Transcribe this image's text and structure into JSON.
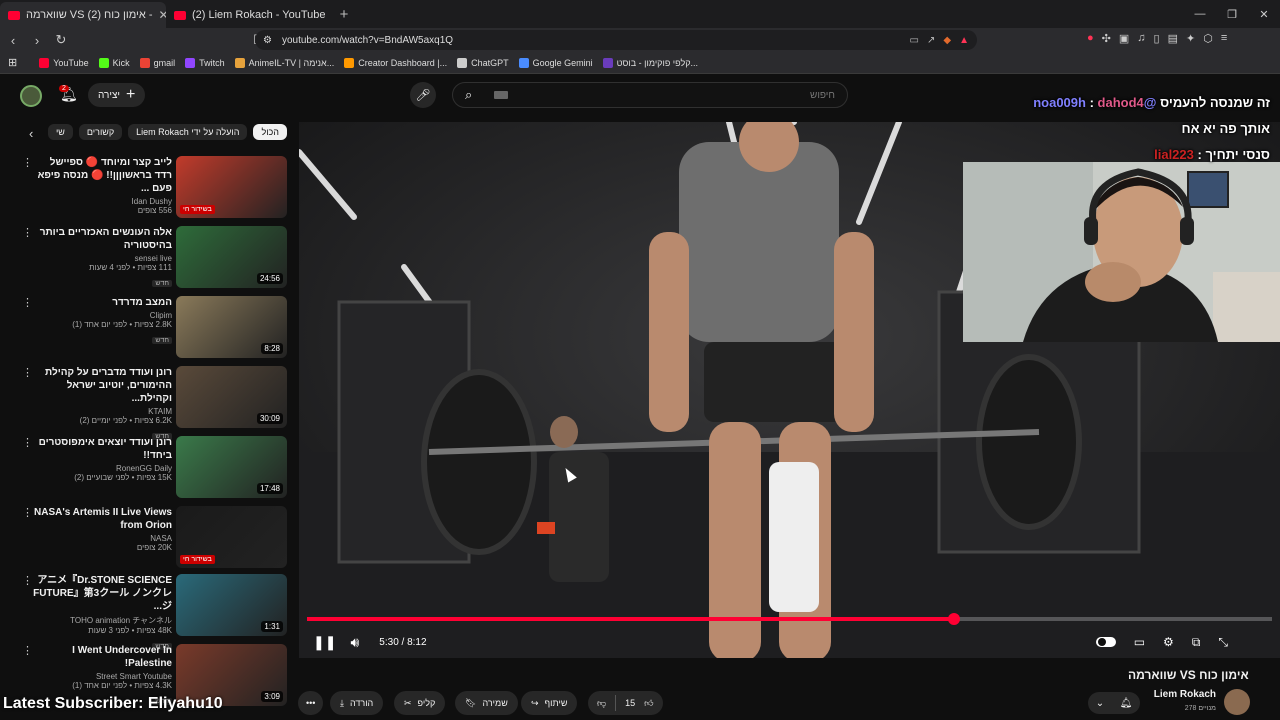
{
  "browser": {
    "tabs": [
      {
        "label": "שווארמה VS אימון כוח (2) -",
        "active": true
      },
      {
        "label": "(2) Liem Rokach - YouTube",
        "active": false
      }
    ],
    "url": "youtube.com/watch?v=BndAW5axq1Q",
    "bookmarks": [
      {
        "label": "YouTube",
        "color": "#ff0033"
      },
      {
        "label": "Kick",
        "color": "#53fc18"
      },
      {
        "label": "gmail",
        "color": "#ea4335"
      },
      {
        "label": "Twitch",
        "color": "#9146ff"
      },
      {
        "label": "AnimeIL-TV | אנימה...",
        "color": "#e6a23c"
      },
      {
        "label": "Creator Dashboard |...",
        "color": "#ff9900"
      },
      {
        "label": "ChatGPT",
        "color": "#cccccc"
      },
      {
        "label": "Google Gemini",
        "color": "#4a8cff"
      },
      {
        "label": "קלפי פוקימון - בוסט...",
        "color": "#6a3cbc"
      }
    ]
  },
  "header": {
    "notif_count": "2",
    "create_label": "יצירה",
    "search_placeholder": "חיפוש"
  },
  "filters": [
    "הכול",
    "הועלה על ידי Liem Rokach",
    "קשורים",
    "שי"
  ],
  "recs": [
    {
      "title": "לייב קצר ומיוחד 🔴 ספיישל רדד בראשוןןן!! 🔴 מנסה פיפא פעם ...",
      "channel": "Idan Dushy",
      "views": "556 צופים",
      "live": "בשידור חי",
      "dur": "",
      "newb": "",
      "color": "#c23b2b"
    },
    {
      "title": "אלה העונשים האכזריים ביותר בהיסטוריה",
      "channel": "sensei live",
      "views": "111 צפיות • לפני 4 שעות",
      "live": "",
      "dur": "24:56",
      "newb": "חדש",
      "color": "#2e6c3a"
    },
    {
      "title": "המצב מדרדר",
      "channel": "Clipim",
      "views": "2.8K צפיות • לפני יום אחד (1)",
      "live": "",
      "dur": "8:28",
      "newb": "חדש",
      "color": "#8a7a5a"
    },
    {
      "title": "רונן ועודד מדברים על קהילת ההימורים, יוטיוב ישראל וקהילת...",
      "channel": "KTAIM",
      "views": "6.2K צפיות • לפני יומיים (2)",
      "live": "",
      "dur": "30:09",
      "newb": "חדש",
      "color": "#5a4a3a"
    },
    {
      "title": "רונן ועודד יוצאים אימפוסטרים ביחד!!",
      "channel": "RonenGG Daily",
      "views": "15K צפיות • לפני שבועיים (2)",
      "live": "",
      "dur": "17:48",
      "newb": "",
      "color": "#3a7a4a"
    },
    {
      "title": "NASA's Artemis II Live Views from Orion",
      "channel": "NASA",
      "views": "20K צופים",
      "live": "בשידור חי",
      "dur": "",
      "newb": "",
      "color": "#1a1a1a"
    },
    {
      "title": "アニメ『Dr.STONE SCIENCE FUTURE』第3クール ノンクレジ...",
      "channel": "TOHO animation チャンネル",
      "views": "48K צפיות • לפני 3 שעות",
      "live": "",
      "dur": "1:31",
      "newb": "חדש",
      "color": "#2a6a7a"
    },
    {
      "title": "I Went Undercover In Palestine!",
      "channel": "Street Smart Youtube",
      "views": "4.3K צפיות • לפני יום אחד (1)",
      "live": "",
      "dur": "3:09",
      "newb": "חדש",
      "color": "#7a3a2a"
    }
  ],
  "player": {
    "time": "5:30 / 8:12",
    "progress": 0.6707
  },
  "chat": [
    {
      "name": "dahod4",
      "sep": " : ",
      "msg": "@noa009h",
      "rest": "זה שמנסה להעמיס"
    },
    {
      "name": "",
      "sep": "",
      "msg": "אותך פה יא אח",
      "rest": ""
    },
    {
      "name": "lial223",
      "sep": " : ",
      "msg": "סנסי יתחיך",
      "rest": ""
    }
  ],
  "video": {
    "title": "שווארמה VS אימון כוח",
    "owner": "Liem Rokach",
    "subs": "278 מנויים",
    "likes": "15"
  },
  "actions": {
    "share": "שיתוף",
    "save": "שמירה",
    "clip": "קליפ",
    "download": "הורדה"
  },
  "overlay": "Latest Subscriber: Eliyahu10"
}
